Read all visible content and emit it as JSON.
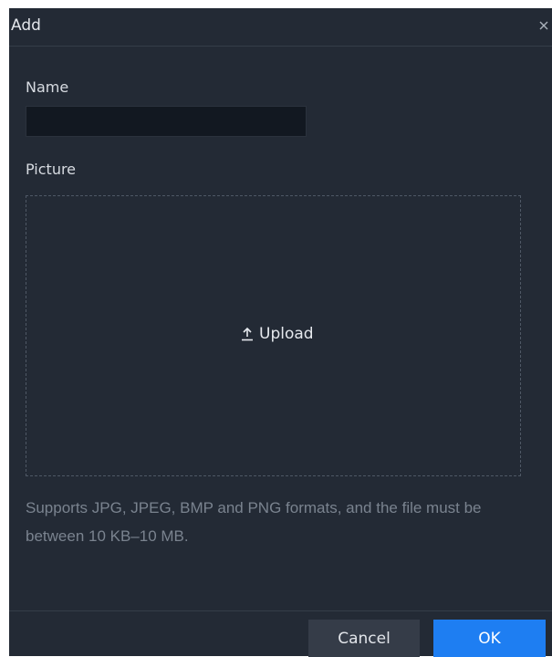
{
  "dialog": {
    "title": "Add",
    "close_icon": "close-icon"
  },
  "form": {
    "name_label": "Name",
    "name_value": "",
    "picture_label": "Picture",
    "upload_label": "Upload",
    "upload_icon": "upload-icon",
    "hint": "Supports JPG, JPEG, BMP and PNG formats, and the file must be between 10 KB–10 MB."
  },
  "footer": {
    "cancel_label": "Cancel",
    "ok_label": "OK"
  },
  "colors": {
    "background": "#232a35",
    "input_background": "#121821",
    "accent": "#1e7ef2",
    "secondary_button": "#353c48"
  }
}
